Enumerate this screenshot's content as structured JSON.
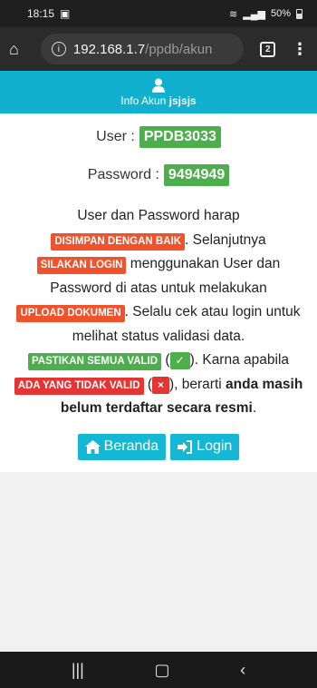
{
  "status": {
    "time": "18:15",
    "battery": "50%"
  },
  "browser": {
    "host": "192.168.1.7",
    "path": "/ppdb/akun",
    "tab_count": "2"
  },
  "header": {
    "label": "Info Akun",
    "username": "jsjsjs"
  },
  "account": {
    "user_label": "User :",
    "user_value": "PPDB3033",
    "password_label": "Password :",
    "password_value": "9494949"
  },
  "message": {
    "t1": "User dan Password harap ",
    "b1": "DISIMPAN DENGAN BAIK",
    "t2": ". Selanjutnya ",
    "b2": "SILAKAN LOGIN",
    "t3": " menggunakan User dan Password di atas untuk melakukan ",
    "b3": "UPLOAD DOKUMEN",
    "t4": ". Selalu cek atau login untuk melihat status validasi data. ",
    "b4": "PASTIKAN SEMUA VALID",
    "t5": " (",
    "t6": "). Karna apabila ",
    "b5": "ADA YANG TIDAK VALID",
    "t7": " (",
    "t8": "), berarti ",
    "strong": "anda masih belum terdaftar secara resmi",
    "t9": "."
  },
  "buttons": {
    "beranda": "Beranda",
    "login": "Login"
  },
  "colors": {
    "accent": "#14b7d4",
    "green": "#4cae4c",
    "orange": "#f0522b",
    "red": "#e53434"
  }
}
